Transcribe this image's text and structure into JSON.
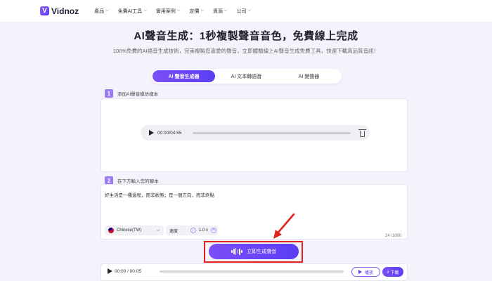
{
  "brand": {
    "logo_letter": "V",
    "name": "Vidnoz"
  },
  "nav": [
    {
      "label": "產品"
    },
    {
      "label": "免費AI工具"
    },
    {
      "label": "實用案例"
    },
    {
      "label": "定價"
    },
    {
      "label": "資源"
    },
    {
      "label": "公司"
    }
  ],
  "hero": {
    "title": "AI聲音生成：1秒複製聲音音色，免費線上完成",
    "subtitle": "100%免費的AI語音生成技術，完美複製您喜愛的聲音，立即體驗線上AI聲音生成免費工具，快速下載高品質音訊！"
  },
  "tabs": [
    {
      "label": "AI 聲音生成器",
      "active": true
    },
    {
      "label": "AI 文本轉語音",
      "active": false
    },
    {
      "label": "AI 變聲器",
      "active": false
    }
  ],
  "step1": {
    "number": "1",
    "label": "添加AI聲音模仿樣本",
    "player_time": "00:00/04:55"
  },
  "step2": {
    "number": "2",
    "label": "在下方輸入您的腳本",
    "script": "好生活是一種過程，而非狀態；是一個方向，而非終點",
    "language": "Chinese(TW)",
    "speed_label": "速度",
    "speed_minus": "−",
    "speed_value": "1.0 x",
    "speed_plus": "+",
    "char_count": "24 /1000"
  },
  "generate": {
    "label": "立即生成聲音"
  },
  "output_player": {
    "time": "00:00 / 00:05",
    "play_label": "播放",
    "download_label": "下載"
  },
  "colors": {
    "accent": "#5b3df5",
    "annotation": "#e0231c"
  }
}
